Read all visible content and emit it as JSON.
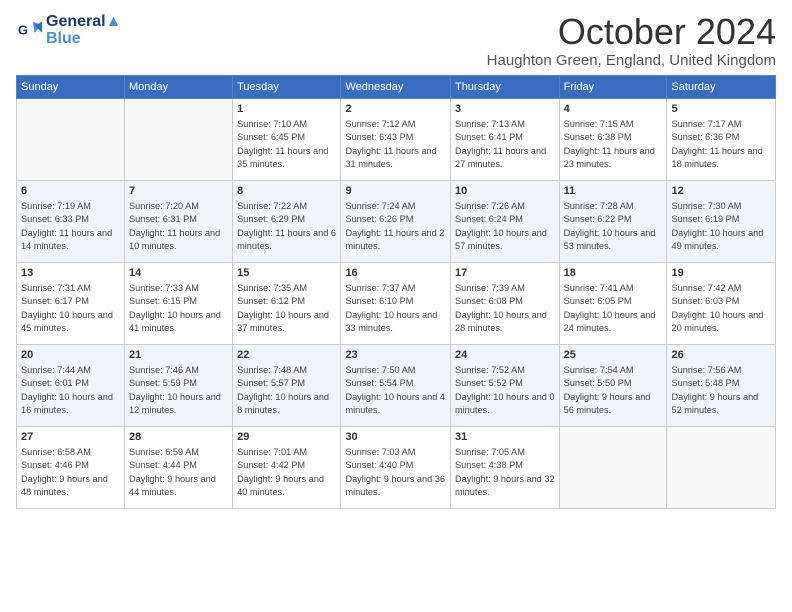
{
  "header": {
    "logo_line1": "General",
    "logo_line2": "Blue",
    "month": "October 2024",
    "location": "Haughton Green, England, United Kingdom"
  },
  "weekdays": [
    "Sunday",
    "Monday",
    "Tuesday",
    "Wednesday",
    "Thursday",
    "Friday",
    "Saturday"
  ],
  "rows": [
    [
      {
        "day": "",
        "info": ""
      },
      {
        "day": "",
        "info": ""
      },
      {
        "day": "1",
        "info": "Sunrise: 7:10 AM\nSunset: 6:45 PM\nDaylight: 11 hours and 35 minutes."
      },
      {
        "day": "2",
        "info": "Sunrise: 7:12 AM\nSunset: 6:43 PM\nDaylight: 11 hours and 31 minutes."
      },
      {
        "day": "3",
        "info": "Sunrise: 7:13 AM\nSunset: 6:41 PM\nDaylight: 11 hours and 27 minutes."
      },
      {
        "day": "4",
        "info": "Sunrise: 7:15 AM\nSunset: 6:38 PM\nDaylight: 11 hours and 23 minutes."
      },
      {
        "day": "5",
        "info": "Sunrise: 7:17 AM\nSunset: 6:36 PM\nDaylight: 11 hours and 18 minutes."
      }
    ],
    [
      {
        "day": "6",
        "info": "Sunrise: 7:19 AM\nSunset: 6:33 PM\nDaylight: 11 hours and 14 minutes."
      },
      {
        "day": "7",
        "info": "Sunrise: 7:20 AM\nSunset: 6:31 PM\nDaylight: 11 hours and 10 minutes."
      },
      {
        "day": "8",
        "info": "Sunrise: 7:22 AM\nSunset: 6:29 PM\nDaylight: 11 hours and 6 minutes."
      },
      {
        "day": "9",
        "info": "Sunrise: 7:24 AM\nSunset: 6:26 PM\nDaylight: 11 hours and 2 minutes."
      },
      {
        "day": "10",
        "info": "Sunrise: 7:26 AM\nSunset: 6:24 PM\nDaylight: 10 hours and 57 minutes."
      },
      {
        "day": "11",
        "info": "Sunrise: 7:28 AM\nSunset: 6:22 PM\nDaylight: 10 hours and 53 minutes."
      },
      {
        "day": "12",
        "info": "Sunrise: 7:30 AM\nSunset: 6:19 PM\nDaylight: 10 hours and 49 minutes."
      }
    ],
    [
      {
        "day": "13",
        "info": "Sunrise: 7:31 AM\nSunset: 6:17 PM\nDaylight: 10 hours and 45 minutes."
      },
      {
        "day": "14",
        "info": "Sunrise: 7:33 AM\nSunset: 6:15 PM\nDaylight: 10 hours and 41 minutes."
      },
      {
        "day": "15",
        "info": "Sunrise: 7:35 AM\nSunset: 6:12 PM\nDaylight: 10 hours and 37 minutes."
      },
      {
        "day": "16",
        "info": "Sunrise: 7:37 AM\nSunset: 6:10 PM\nDaylight: 10 hours and 33 minutes."
      },
      {
        "day": "17",
        "info": "Sunrise: 7:39 AM\nSunset: 6:08 PM\nDaylight: 10 hours and 28 minutes."
      },
      {
        "day": "18",
        "info": "Sunrise: 7:41 AM\nSunset: 6:05 PM\nDaylight: 10 hours and 24 minutes."
      },
      {
        "day": "19",
        "info": "Sunrise: 7:42 AM\nSunset: 6:03 PM\nDaylight: 10 hours and 20 minutes."
      }
    ],
    [
      {
        "day": "20",
        "info": "Sunrise: 7:44 AM\nSunset: 6:01 PM\nDaylight: 10 hours and 16 minutes."
      },
      {
        "day": "21",
        "info": "Sunrise: 7:46 AM\nSunset: 5:59 PM\nDaylight: 10 hours and 12 minutes."
      },
      {
        "day": "22",
        "info": "Sunrise: 7:48 AM\nSunset: 5:57 PM\nDaylight: 10 hours and 8 minutes."
      },
      {
        "day": "23",
        "info": "Sunrise: 7:50 AM\nSunset: 5:54 PM\nDaylight: 10 hours and 4 minutes."
      },
      {
        "day": "24",
        "info": "Sunrise: 7:52 AM\nSunset: 5:52 PM\nDaylight: 10 hours and 0 minutes."
      },
      {
        "day": "25",
        "info": "Sunrise: 7:54 AM\nSunset: 5:50 PM\nDaylight: 9 hours and 56 minutes."
      },
      {
        "day": "26",
        "info": "Sunrise: 7:56 AM\nSunset: 5:48 PM\nDaylight: 9 hours and 52 minutes."
      }
    ],
    [
      {
        "day": "27",
        "info": "Sunrise: 6:58 AM\nSunset: 4:46 PM\nDaylight: 9 hours and 48 minutes."
      },
      {
        "day": "28",
        "info": "Sunrise: 6:59 AM\nSunset: 4:44 PM\nDaylight: 9 hours and 44 minutes."
      },
      {
        "day": "29",
        "info": "Sunrise: 7:01 AM\nSunset: 4:42 PM\nDaylight: 9 hours and 40 minutes."
      },
      {
        "day": "30",
        "info": "Sunrise: 7:03 AM\nSunset: 4:40 PM\nDaylight: 9 hours and 36 minutes."
      },
      {
        "day": "31",
        "info": "Sunrise: 7:05 AM\nSunset: 4:38 PM\nDaylight: 9 hours and 32 minutes."
      },
      {
        "day": "",
        "info": ""
      },
      {
        "day": "",
        "info": ""
      }
    ]
  ]
}
